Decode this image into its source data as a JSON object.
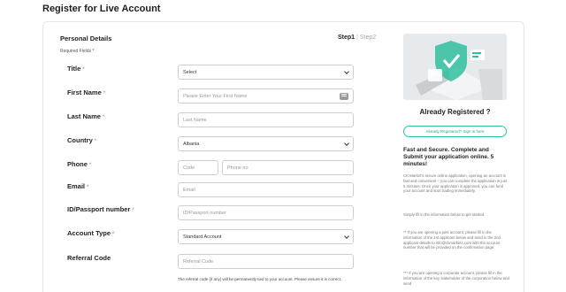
{
  "page": {
    "title": "Register for Live Account"
  },
  "form": {
    "section_title": "Personal Details",
    "required_note": "Required Fields *",
    "steps": {
      "step1": "Step1",
      "separator": "|",
      "step2": "Step2"
    },
    "fields": {
      "title": {
        "label": "Title",
        "value": "Select"
      },
      "first_name": {
        "label": "First Name",
        "placeholder": "Please Enter Your First Name"
      },
      "last_name": {
        "label": "Last Name",
        "placeholder": "Last Name"
      },
      "country": {
        "label": "Country",
        "value": "Albania"
      },
      "phone": {
        "label": "Phone",
        "code_placeholder": "Code",
        "placeholder": "Phone no"
      },
      "email": {
        "label": "Email",
        "placeholder": "Email"
      },
      "id_passport": {
        "label": "ID/Passport number",
        "placeholder": "ID/Passport number"
      },
      "account_type": {
        "label": "Account Type",
        "value": "Standard Account"
      },
      "referral": {
        "label": "Referral Code",
        "placeholder": "Referral Code",
        "note": "The referral code (if any) will be permanently tied to your account. Please ensure it is correct."
      }
    },
    "required_marker": "*"
  },
  "sidebar": {
    "already_title": "Already Registered ?",
    "signin_label": "Already Registered? Sign in here",
    "fast_title": "Fast and Secure. Complete and Submit your application online. 5 minutes!",
    "para1": "CK Market's secure online application, opening an account is fast and convenient – you can complete the application in just 5 minutes. Once your application is approved, you can fund your account and start trading immediately.",
    "para2": "Simply fill in the information below to get started.",
    "para3": "** If you are opening a joint account, please fill in the information of the 1st applicant below and send in the 2nd applicant details to info@ckmarkets.com with the account number that will be provided on the confirmation page.",
    "para4": "*** If you are opening a corporate account, please fill in the information of the key stakeholder of the corporation below and send"
  },
  "colors": {
    "accent": "#2fc0a0",
    "required": "#e55555",
    "border": "#cfcfcf"
  }
}
